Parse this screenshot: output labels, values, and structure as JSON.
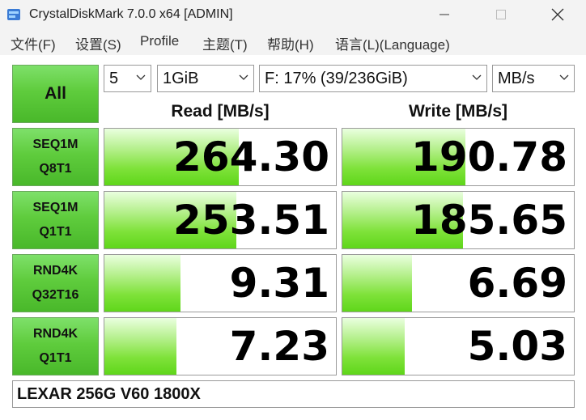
{
  "window": {
    "title": "CrystalDiskMark 7.0.0 x64 [ADMIN]"
  },
  "menu": {
    "items": [
      "文件(F)",
      "设置(S)",
      "Profile",
      "主题(T)",
      "帮助(H)",
      "语言(L)(Language)"
    ]
  },
  "controls": {
    "all_label": "All",
    "count": "5",
    "size": "1GiB",
    "drive": "F: 17% (39/236GiB)",
    "unit": "MB/s"
  },
  "headers": {
    "read": "Read [MB/s]",
    "write": "Write [MB/s]"
  },
  "tests": [
    {
      "line1": "SEQ1M",
      "line2": "Q8T1",
      "read": "264.30",
      "write": "190.78",
      "read_fill": 0.58,
      "write_fill": 0.53
    },
    {
      "line1": "SEQ1M",
      "line2": "Q1T1",
      "read": "253.51",
      "write": "185.65",
      "read_fill": 0.57,
      "write_fill": 0.52
    },
    {
      "line1": "RND4K",
      "line2": "Q32T16",
      "read": "9.31",
      "write": "6.69",
      "read_fill": 0.33,
      "write_fill": 0.3
    },
    {
      "line1": "RND4K",
      "line2": "Q1T1",
      "read": "7.23",
      "write": "5.03",
      "read_fill": 0.31,
      "write_fill": 0.27
    }
  ],
  "comment": "LEXAR 256G V60 1800X",
  "colors": {
    "button_green": "#5fcc3d",
    "bar_green": "#7fe23a"
  }
}
